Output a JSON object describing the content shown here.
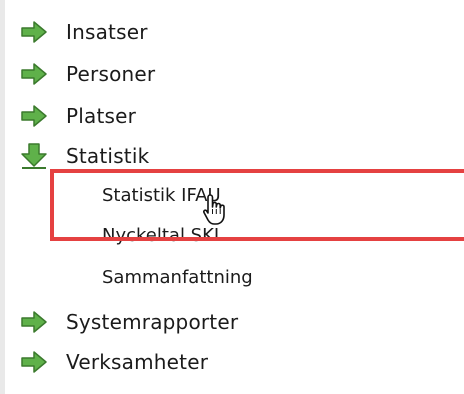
{
  "nav": {
    "items": [
      {
        "label": "Insatser",
        "icon": "arrow-right-icon"
      },
      {
        "label": "Personer",
        "icon": "arrow-right-icon"
      },
      {
        "label": "Platser",
        "icon": "arrow-right-icon"
      },
      {
        "label": "Statistik",
        "icon": "arrow-down-icon"
      },
      {
        "label": "Systemrapporter",
        "icon": "arrow-right-icon"
      },
      {
        "label": "Verksamheter",
        "icon": "arrow-right-icon"
      }
    ],
    "statistik_subitems": [
      {
        "label": "Statistik IFAU"
      },
      {
        "label": "Nyckeltal SKL"
      },
      {
        "label": "Sammanfattning"
      }
    ]
  },
  "colors": {
    "arrow_green": "#5fb14a",
    "arrow_outline": "#3b7a2d",
    "highlight_red": "#e54141"
  }
}
